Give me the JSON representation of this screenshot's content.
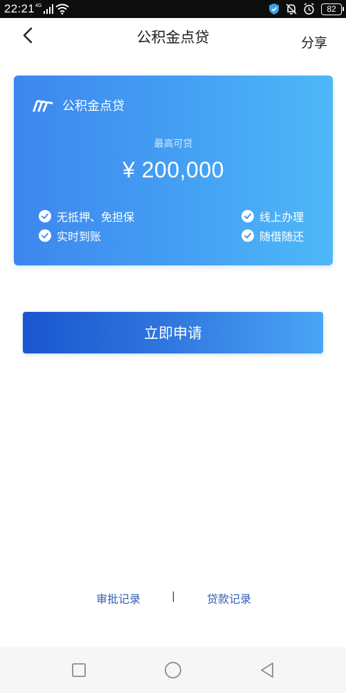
{
  "status_bar": {
    "time": "22:21",
    "network_type": "4G",
    "battery_level": "82"
  },
  "nav": {
    "title": "公积金点贷",
    "share_label": "分享"
  },
  "card": {
    "product_name": "公积金点贷",
    "max_label": "最高可贷",
    "max_amount": "¥ 200,000",
    "features": [
      "无抵押、免担保",
      "线上办理",
      "实时到账",
      "随借随还"
    ],
    "gradient_start": "#3d86ee",
    "gradient_end": "#4fb8f8"
  },
  "apply_button": {
    "label": "立即申请",
    "color_start": "#1a56cf",
    "color_end": "#4aa4f6"
  },
  "footer_links": {
    "approval_record": "审批记录",
    "divider": "|",
    "loan_record": "贷款记录"
  },
  "icons": [
    "back-icon",
    "share",
    "logo-icon",
    "check-icon",
    "square-icon",
    "circle-icon",
    "triangle-back-icon"
  ],
  "accent_color": "#2c5fb8"
}
